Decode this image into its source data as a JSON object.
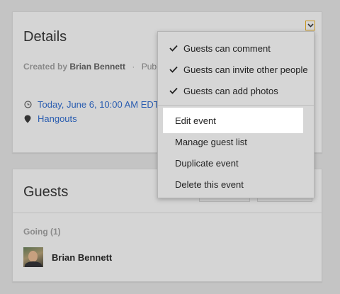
{
  "details": {
    "title": "Details",
    "created_by_prefix": "Created by",
    "creator": "Brian Bennett",
    "separator": "·",
    "visibility": "Publi",
    "datetime": "Today, June 6, 10:00 AM EDT",
    "location": "Hangouts"
  },
  "guests": {
    "title": "Guests",
    "going_label": "Going (1)",
    "people": [
      {
        "name": "Brian Bennett"
      }
    ]
  },
  "menu": {
    "options": [
      {
        "label": "Guests can comment",
        "checked": true
      },
      {
        "label": "Guests can invite other people",
        "checked": true
      },
      {
        "label": "Guests can add photos",
        "checked": true
      }
    ],
    "actions": [
      {
        "label": "Edit event",
        "highlighted": true
      },
      {
        "label": "Manage guest list"
      },
      {
        "label": "Duplicate event"
      },
      {
        "label": "Delete this event"
      }
    ]
  },
  "colors": {
    "link": "#2a5db0",
    "menu_toggle_border": "#c89620"
  },
  "icons": {
    "clock": "clock-icon",
    "location": "map-pin-icon",
    "check": "check-icon",
    "toggle": "chevron-down-icon"
  }
}
